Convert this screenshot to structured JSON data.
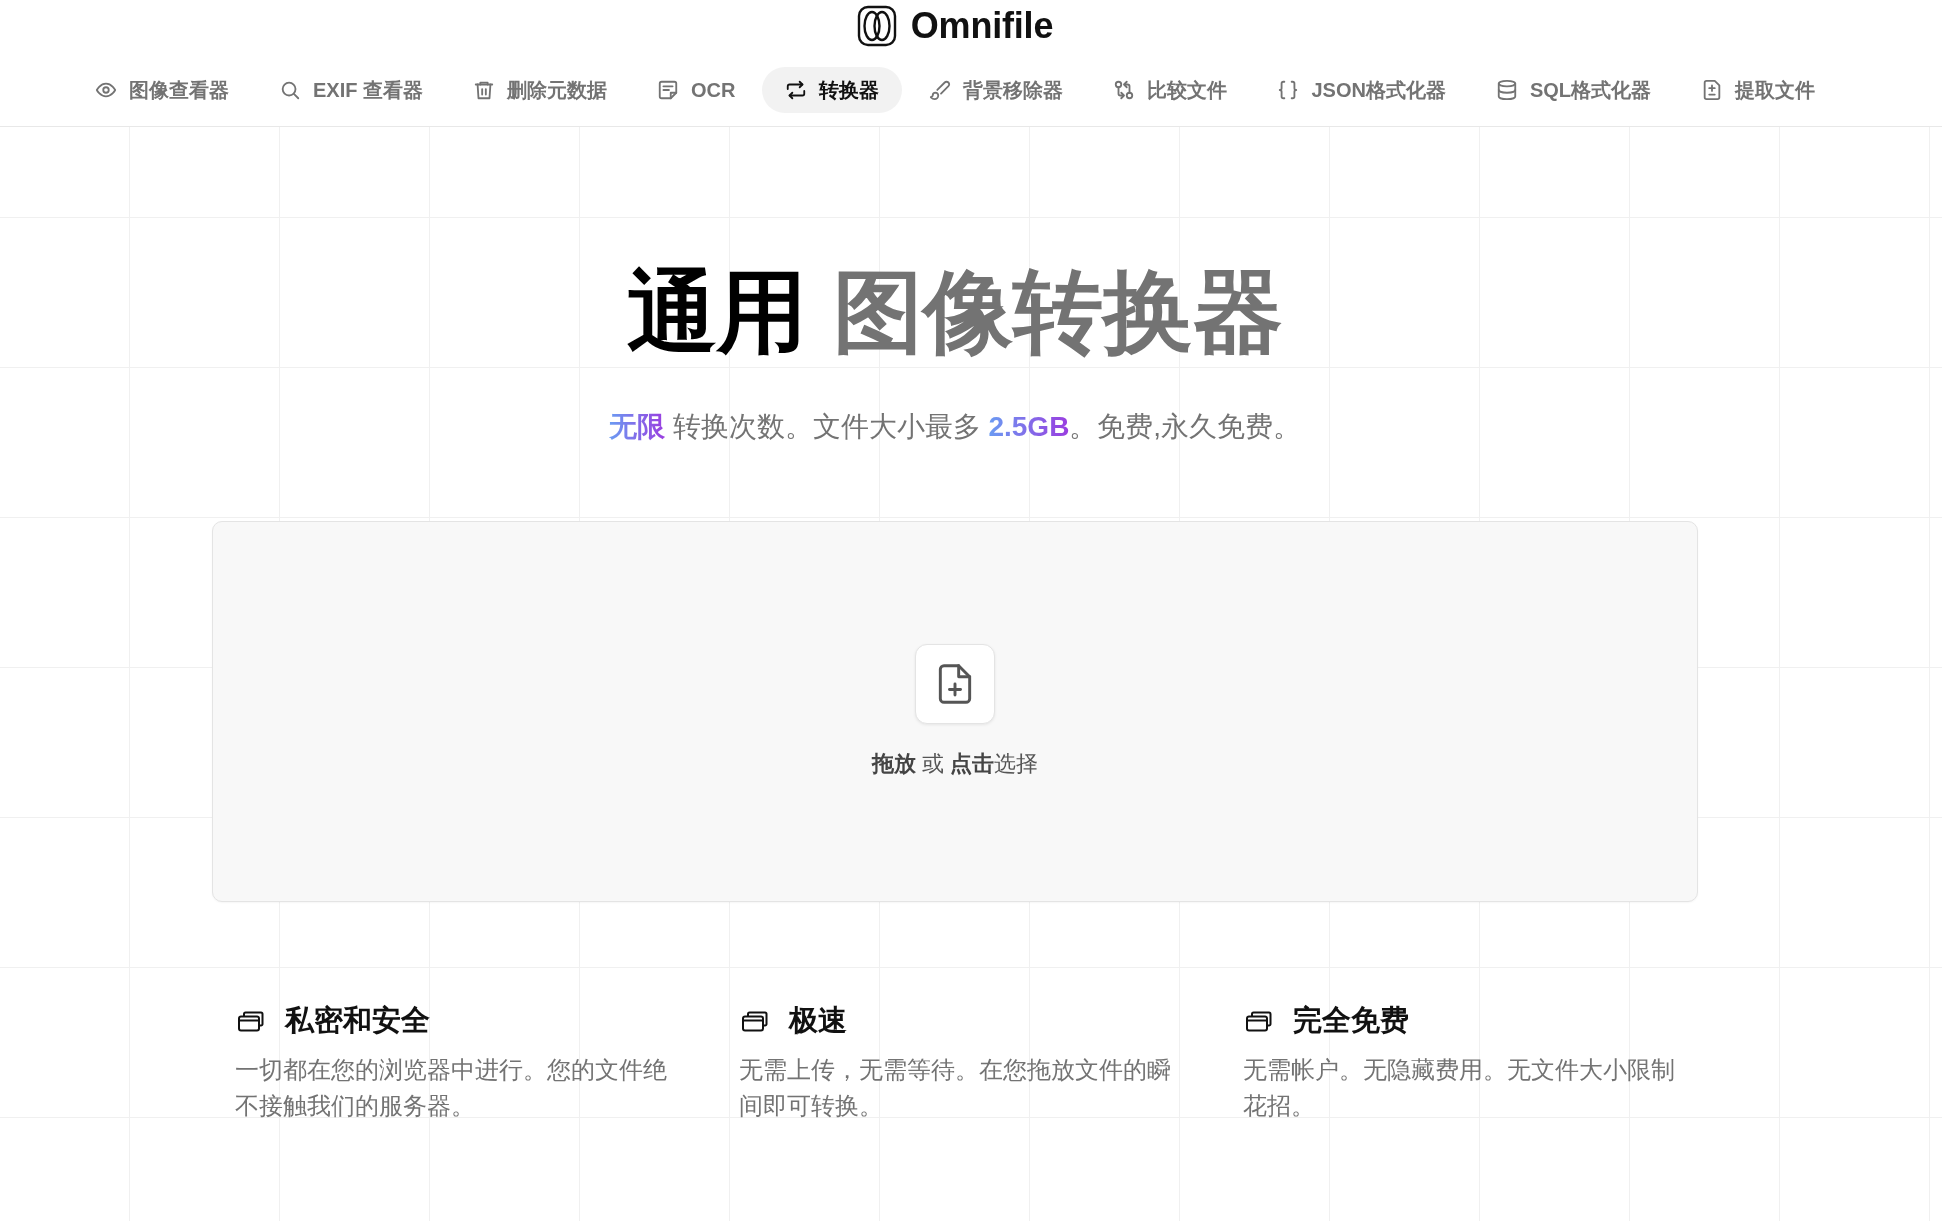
{
  "header": {
    "brand": "Omnifile"
  },
  "nav": [
    {
      "label": "图像查看器",
      "selected": false
    },
    {
      "label": "EXIF 查看器",
      "selected": false
    },
    {
      "label": "删除元数据",
      "selected": false
    },
    {
      "label": "OCR",
      "selected": false
    },
    {
      "label": "转换器",
      "selected": true
    },
    {
      "label": "背景移除器",
      "selected": false
    },
    {
      "label": "比较文件",
      "selected": false
    },
    {
      "label": "JSON格式化器",
      "selected": false
    },
    {
      "label": "SQL格式化器",
      "selected": false
    },
    {
      "label": "提取文件",
      "selected": false
    }
  ],
  "hero": {
    "title_lead": "通用",
    "title_highlight": "图像转换器",
    "subtitle": "**无限** 转换次数。文件大小最多 **2.5GB**。免费,永久免费。"
  },
  "dropzone": {
    "prompt": "**拖放** 或 **点击**选择"
  },
  "features": [
    {
      "title": "私密和安全",
      "description": "一切都在您的浏览器中进行。您的文件绝不接触我们的服务器。"
    },
    {
      "title": "极速",
      "description": "无需上传，无需等待。在您拖放文件的瞬间即可转换。"
    },
    {
      "title": "完全免费",
      "description": "无需帐户。无隐藏费用。无文件大小限制花招。"
    }
  ]
}
